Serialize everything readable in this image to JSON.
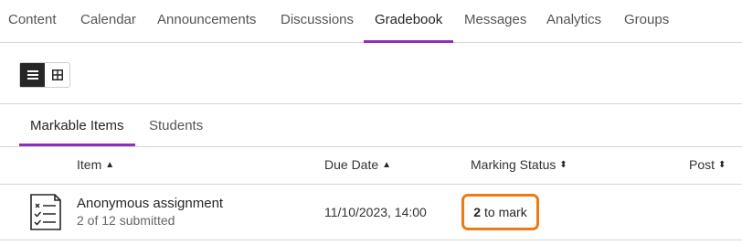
{
  "nav": {
    "tabs": [
      {
        "label": "Content"
      },
      {
        "label": "Calendar"
      },
      {
        "label": "Announcements"
      },
      {
        "label": "Discussions"
      },
      {
        "label": "Gradebook"
      },
      {
        "label": "Messages"
      },
      {
        "label": "Analytics"
      },
      {
        "label": "Groups"
      }
    ],
    "active": "Gradebook"
  },
  "view_toggle": {
    "options": [
      {
        "icon": "list-view-icon",
        "selected": true
      },
      {
        "icon": "grid-view-icon",
        "selected": false
      }
    ]
  },
  "subtabs": [
    {
      "label": "Markable Items"
    },
    {
      "label": "Students"
    }
  ],
  "active_subtab": "Markable Items",
  "table": {
    "columns": [
      {
        "label": "Item",
        "sort_icon": "sort-ascending-icon"
      },
      {
        "label": "Due Date",
        "sort_icon": "sort-both-icon"
      },
      {
        "label": "Marking Status",
        "sort_icon": "sort-both-icon"
      },
      {
        "label": "Post",
        "sort_icon": "sort-both-icon"
      }
    ],
    "rows": [
      {
        "icon": "assignment-checklist-icon",
        "title": "Anonymous assignment",
        "subtitle": "2 of 12 submitted",
        "due_date": "11/10/2023, 14:00",
        "status_count": "2",
        "status_text": "to mark"
      }
    ]
  },
  "colors": {
    "accent": "#8f2dbd",
    "status_highlight": "#ee7a12"
  }
}
